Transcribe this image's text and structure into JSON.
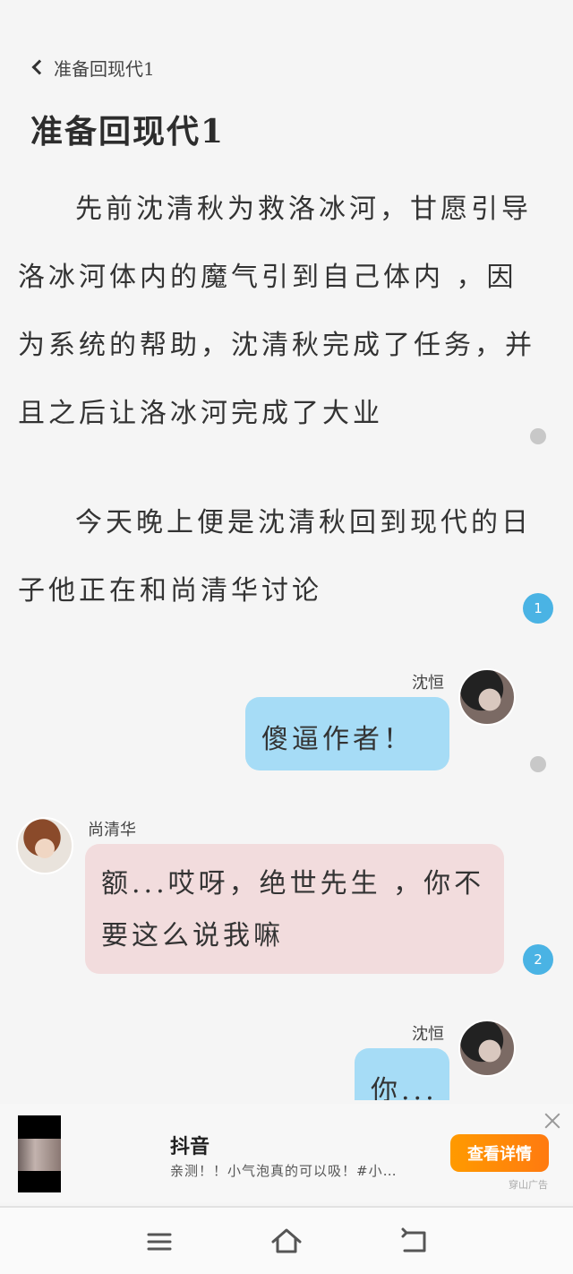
{
  "header": {
    "back_label": "准备回现代1"
  },
  "chapter": {
    "title": "准备回现代1",
    "paragraphs": [
      "先前沈清秋为救洛冰河，甘愿引导洛冰河体内的魔气引到自己体内 ，因为系统的帮助，沈清秋完成了任务，并且之后让洛冰河完成了大业",
      "今天晚上便是沈清秋回到现代的日子他正在和尚清华讨论"
    ]
  },
  "badges": {
    "para2_count": "1",
    "msg2_count": "2"
  },
  "messages": [
    {
      "speaker": "沈恒",
      "text": "傻逼作者！",
      "side": "right"
    },
    {
      "speaker": "尚清华",
      "text": "额...哎呀，绝世先生 ，你不要这么说我嘛",
      "side": "left"
    },
    {
      "speaker": "沈恒",
      "text": "你...",
      "side": "right"
    }
  ],
  "ad": {
    "app_name": "抖音",
    "description": "亲测！！小气泡真的可以吸！#小…",
    "button_label": "查看详情",
    "tag": "穿山广告"
  },
  "colors": {
    "bubble_blue": "#a6dcf6",
    "bubble_pink": "#f2dcdd",
    "badge_blue": "#4ab3e4",
    "ad_orange": "#ff8c00"
  },
  "icons": [
    "chevron-left-icon",
    "close-icon",
    "menu-icon",
    "home-icon",
    "back-icon"
  ]
}
